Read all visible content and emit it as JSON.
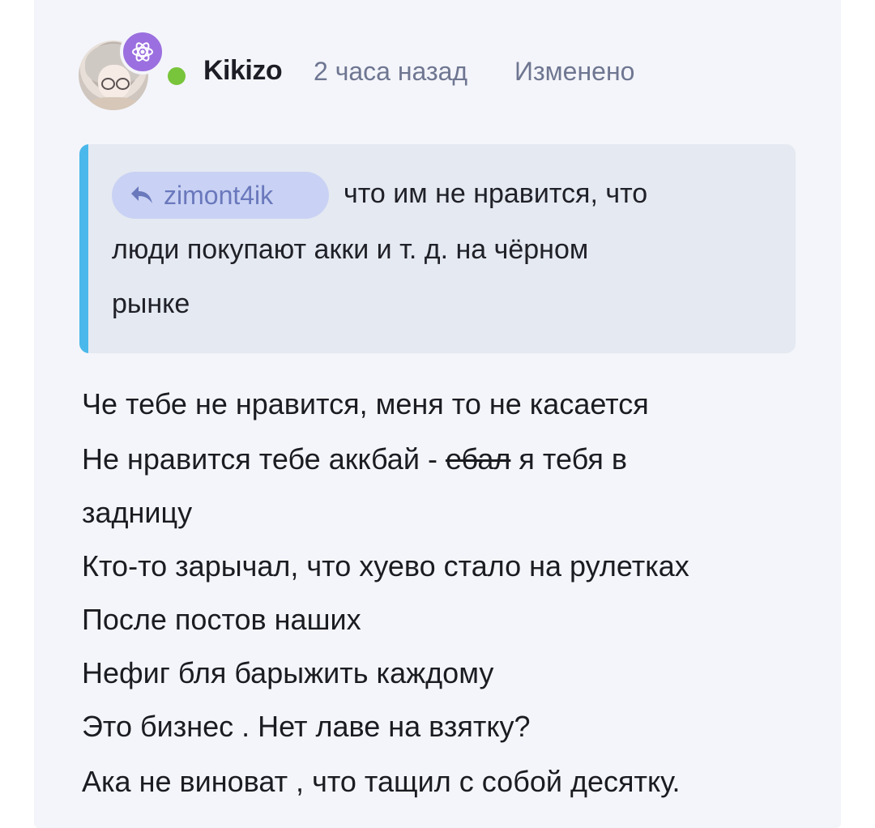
{
  "comment": {
    "author": "Kikizo",
    "time": "2 часа назад",
    "edited_label": "Изменено",
    "online_color": "#78c43b",
    "badge_icon": "atom-icon",
    "avatar_icon": "user-avatar"
  },
  "quote": {
    "mention": "zimont4ik",
    "mention_icon": "reply-arrow-icon",
    "lines": [
      "что им не нравится, что",
      "люди покупают акки и т. д. на чёрном",
      "рынке"
    ]
  },
  "body": {
    "line1": "Че тебе не нравится, меня то не касается",
    "line2_a": "Не нравится тебе аккбай - ",
    "line2_strike": "ебал",
    "line2_b": " я тебя в",
    "line3": "задницу",
    "line4": "Кто-то зарычал, что хуево стало на рулетках",
    "line5": "После постов наших",
    "line6": "Нефиг бля барыжить каждому",
    "line7": "Это бизнес . Нет лаве на взятку?",
    "line8": "Ака не виноват , что тащил с собой десятку."
  }
}
